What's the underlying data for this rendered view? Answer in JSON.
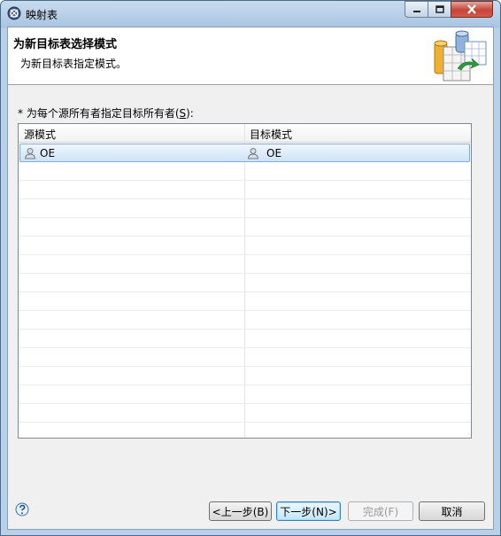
{
  "window": {
    "title": "映射表",
    "controls": {
      "minimize": "minimize",
      "maximize": "maximize",
      "close": "close"
    }
  },
  "header": {
    "title": "为新目标表选择模式",
    "description": "为新目标表指定模式。"
  },
  "mapping": {
    "label_prefix": "* 为每个源所有者指定目标所有者(",
    "label_mnemonic": "S",
    "label_suffix": "):",
    "columns": [
      "源模式",
      "目标模式"
    ],
    "rows": [
      {
        "source": "OE",
        "target": "OE",
        "selected": true
      }
    ]
  },
  "buttons": {
    "back": "<上一步(B)",
    "next": "下一步(N)>",
    "finish": "完成(F)",
    "cancel": "取消"
  },
  "icons": {
    "app": "eclipse-icon",
    "header": "database-table-icon",
    "row": "user-icon",
    "help": "help-icon"
  }
}
